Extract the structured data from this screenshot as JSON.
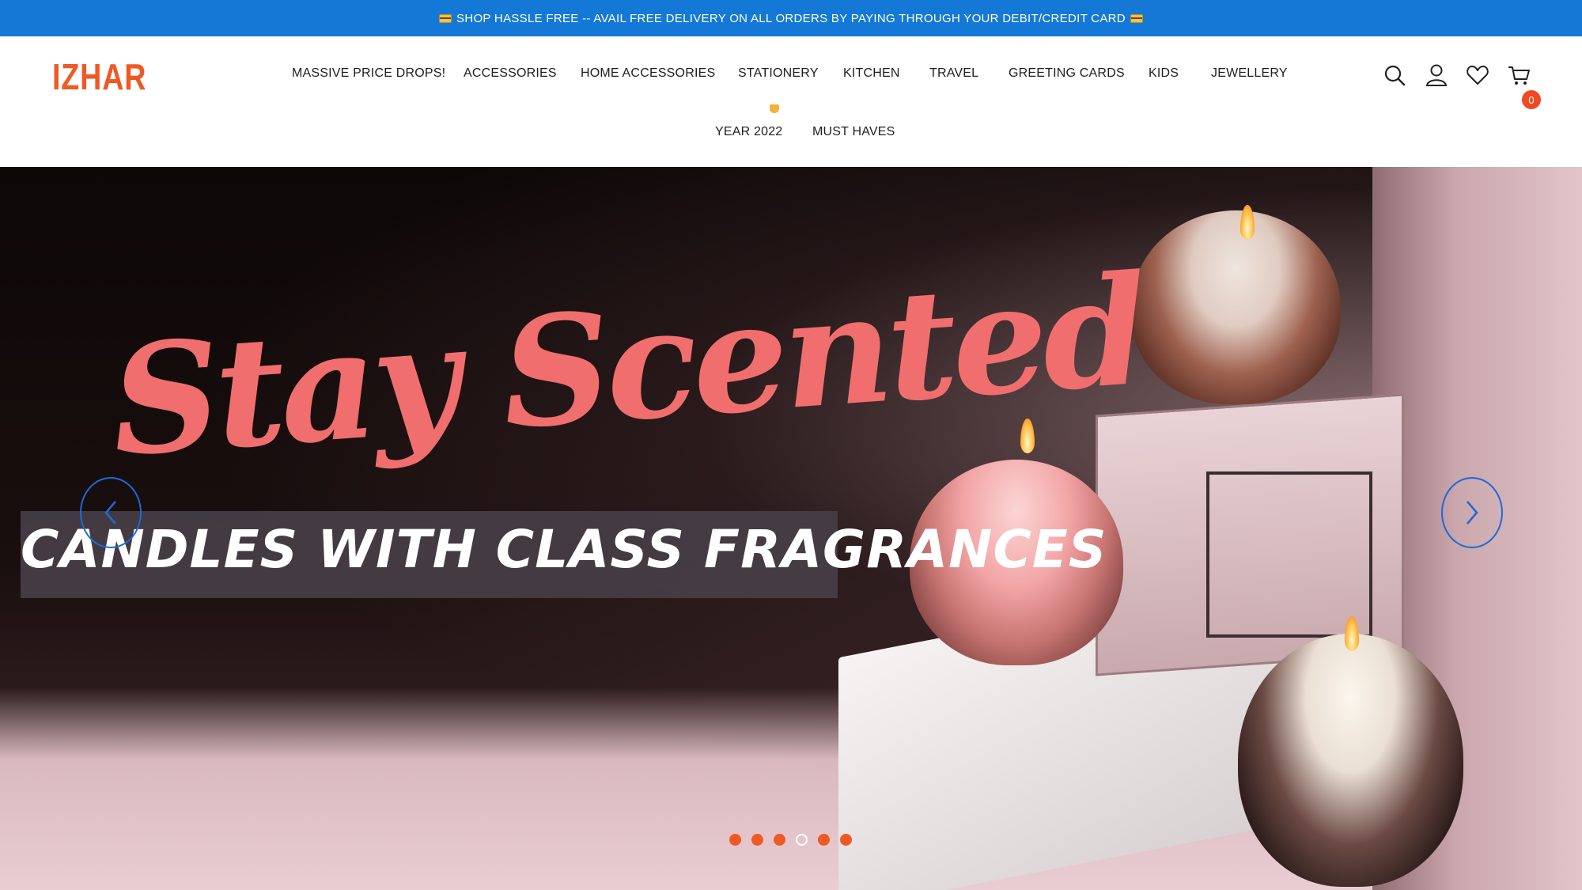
{
  "announcement": {
    "text": "SHOP HASSLE FREE -- AVAIL FREE DELIVERY ON ALL ORDERS BY PAYING THROUGH YOUR DEBIT/CREDIT CARD",
    "icon": "credit-card-icon"
  },
  "header": {
    "logo": "IZHAR",
    "nav": [
      {
        "label": "MASSIVE PRICE DROPS!"
      },
      {
        "label": "ACCESSORIES"
      },
      {
        "label": "HOME ACCESSORIES"
      },
      {
        "label": "STATIONERY"
      },
      {
        "label": "KITCHEN"
      },
      {
        "label": "TRAVEL"
      },
      {
        "label": "GREETING CARDS"
      },
      {
        "label": "KIDS"
      },
      {
        "label": "JEWELLERY"
      },
      {
        "label": "YEAR 2022"
      },
      {
        "label": "MUST HAVES"
      }
    ],
    "icons": [
      "search-icon",
      "account-icon",
      "wishlist-icon",
      "cart-icon"
    ],
    "cart_count": "0"
  },
  "hero": {
    "title": "Stay Scented",
    "subtitle": "CANDLES WITH CLASS FRAGRANCES",
    "slides": 6,
    "active_slide": 4
  },
  "colors": {
    "announcement_bg": "#1479d6",
    "brand": "#ee5a24",
    "title": "#f06e6e"
  }
}
